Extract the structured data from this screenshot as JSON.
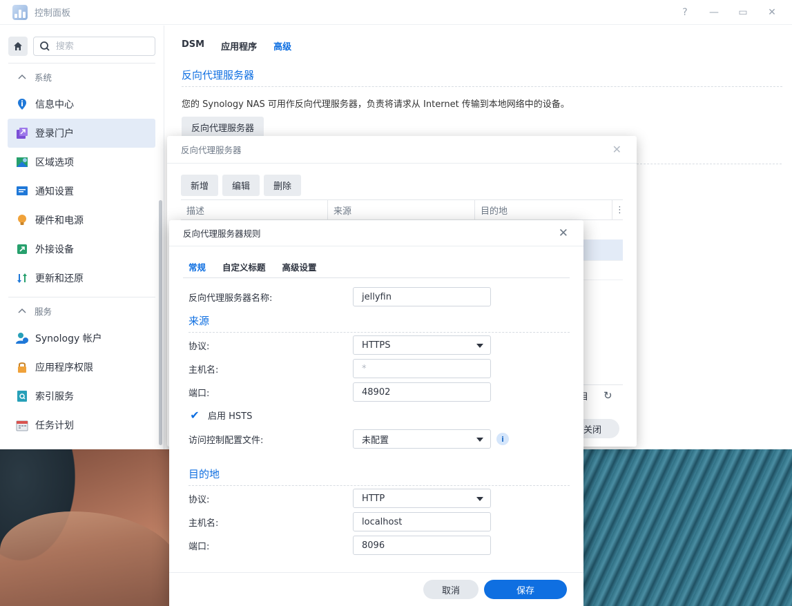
{
  "window": {
    "title": "控制面板",
    "controls": [
      "?",
      "—",
      "▭",
      "✕"
    ]
  },
  "sidebar": {
    "search_placeholder": "搜索",
    "groups": [
      {
        "label": "系统",
        "items": [
          {
            "label": "信息中心",
            "icon": "info-icon",
            "color": "#1f78d8"
          },
          {
            "label": "登录门户",
            "icon": "login-portal-icon",
            "color": "#7b4fd6",
            "active": true
          },
          {
            "label": "区域选项",
            "icon": "region-icon",
            "color": "#27a06d"
          },
          {
            "label": "通知设置",
            "icon": "notification-icon",
            "color": "#1f78d8"
          },
          {
            "label": "硬件和电源",
            "icon": "lightbulb-icon",
            "color": "#f0a23a"
          },
          {
            "label": "外接设备",
            "icon": "external-device-icon",
            "color": "#27a06d"
          },
          {
            "label": "更新和还原",
            "icon": "update-icon",
            "color": "#1f78d8"
          }
        ]
      },
      {
        "label": "服务",
        "items": [
          {
            "label": "Synology 帐户",
            "icon": "account-icon",
            "color": "#1f78d8"
          },
          {
            "label": "应用程序权限",
            "icon": "lock-icon",
            "color": "#f0a23a"
          },
          {
            "label": "索引服务",
            "icon": "index-icon",
            "color": "#27a0b8"
          },
          {
            "label": "任务计划",
            "icon": "calendar-icon",
            "color": "#d9534f"
          }
        ]
      }
    ]
  },
  "content": {
    "tabs": [
      "DSM",
      "应用程序",
      "高级"
    ],
    "active_tab": "高级",
    "section_title": "反向代理服务器",
    "description": "您的 Synology NAS 可用作反向代理服务器，负责将请求从 Internet 传输到本地网络中的设备。",
    "button_label": "反向代理服务器"
  },
  "proxy_dialog": {
    "title": "反向代理服务器",
    "toolbar": [
      "新增",
      "编辑",
      "删除"
    ],
    "columns": [
      "描述",
      "来源",
      "目的地"
    ],
    "footer_partial": "目",
    "close_label": "关闭"
  },
  "rule_dialog": {
    "title": "反向代理服务器规则",
    "tabs": [
      "常规",
      "自定义标题",
      "高级设置"
    ],
    "active_tab": "常规",
    "name_label": "反向代理服务器名称:",
    "name_value": "jellyfin",
    "source": {
      "title": "来源",
      "protocol_label": "协议:",
      "protocol_value": "HTTPS",
      "hostname_label": "主机名:",
      "hostname_value": "*",
      "port_label": "端口:",
      "port_value": "48902",
      "hsts_label": "启用 HSTS",
      "hsts_checked": true,
      "acl_label": "访问控制配置文件:",
      "acl_value": "未配置"
    },
    "destination": {
      "title": "目的地",
      "protocol_label": "协议:",
      "protocol_value": "HTTP",
      "hostname_label": "主机名:",
      "hostname_value": "localhost",
      "port_label": "端口:",
      "port_value": "8096"
    },
    "cancel_label": "取消",
    "save_label": "保存"
  },
  "colors": {
    "accent": "#0f6fe1",
    "active_bg": "#e3ebf7"
  }
}
